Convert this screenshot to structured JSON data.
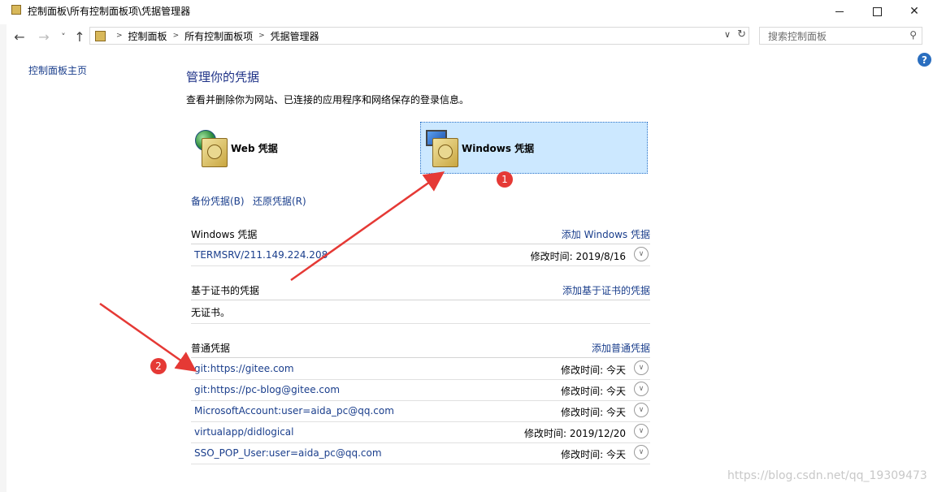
{
  "window": {
    "title": "控制面板\\所有控制面板项\\凭据管理器",
    "minimize_glyph": "—",
    "maximize_glyph": "☐",
    "close_glyph": "✕"
  },
  "nav": {
    "back": "←",
    "forward": "→",
    "recent": "˅",
    "up": "↑",
    "breadcrumbs": [
      "控制面板",
      "所有控制面板项",
      "凭据管理器"
    ],
    "search_placeholder": "搜索控制面板"
  },
  "sidebar": {
    "home_link": "控制面板主页"
  },
  "main": {
    "title": "管理你的凭据",
    "description": "查看并删除你为网站、已连接的应用程序和网络保存的登录信息。",
    "web_credentials_label": "Web 凭据",
    "windows_credentials_label": "Windows 凭据",
    "backup_link": "备份凭据(B)",
    "restore_link": "还原凭据(R)"
  },
  "sections": {
    "windows": {
      "header": "Windows 凭据",
      "add": "添加 Windows 凭据",
      "items": [
        {
          "name": "TERMSRV/211.149.224.208",
          "modified": "修改时间:  2019/8/16"
        }
      ]
    },
    "certificate": {
      "header": "基于证书的凭据",
      "add": "添加基于证书的凭据",
      "empty": "无证书。"
    },
    "generic": {
      "header": "普通凭据",
      "add": "添加普通凭据",
      "items": [
        {
          "name": "git:https://gitee.com",
          "modified": "修改时间:  今天"
        },
        {
          "name": "git:https://pc-blog@gitee.com",
          "modified": "修改时间:  今天"
        },
        {
          "name": "MicrosoftAccount:user=aida_pc@qq.com",
          "modified": "修改时间:  今天"
        },
        {
          "name": "virtualapp/didlogical",
          "modified": "修改时间:  2019/12/20"
        },
        {
          "name": "SSO_POP_User:user=aida_pc@qq.com",
          "modified": "修改时间:  今天"
        }
      ]
    }
  },
  "annotations": {
    "badge1": "1",
    "badge2": "2",
    "color": "#e53935"
  },
  "watermark": "https://blog.csdn.net/qq_19309473",
  "help": "?"
}
